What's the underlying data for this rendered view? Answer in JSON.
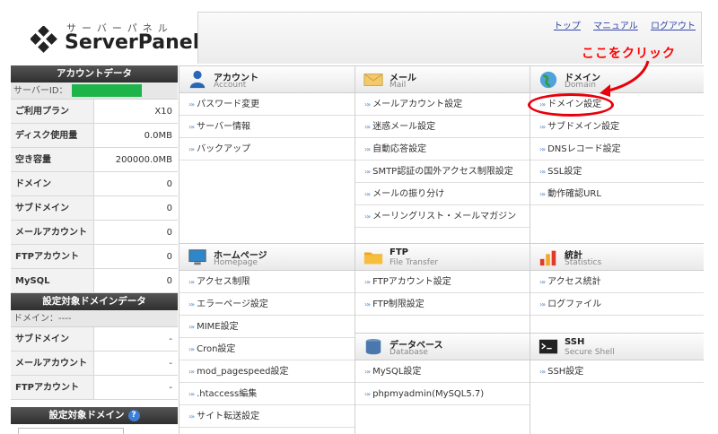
{
  "header": {
    "logo_kana": "サーバーパネル",
    "logo_text": "ServerPanel",
    "links": [
      "トップ",
      "マニュアル",
      "ログアウト"
    ]
  },
  "sidebar": {
    "account_title": "アカウントデータ",
    "server_id_label": "サーバーID：",
    "account_rows": [
      {
        "label": "ご利用プラン",
        "value": "X10"
      },
      {
        "label": "ディスク使用量",
        "value": "0.0MB"
      },
      {
        "label": "空き容量",
        "value": "200000.0MB"
      },
      {
        "label": "ドメイン",
        "value": "0"
      },
      {
        "label": "サブドメイン",
        "value": "0"
      },
      {
        "label": "メールアカウント",
        "value": "0"
      },
      {
        "label": "FTPアカウント",
        "value": "0"
      },
      {
        "label": "MySQL",
        "value": "0"
      }
    ],
    "domain_data_title": "設定対象ドメインデータ",
    "domain_label": "ドメイン：----",
    "domain_rows": [
      {
        "label": "サブドメイン",
        "value": "-"
      },
      {
        "label": "メールアカウント",
        "value": "-"
      },
      {
        "label": "FTPアカウント",
        "value": "-"
      }
    ],
    "target_domain_title": "設定対象ドメイン",
    "help_glyph": "?"
  },
  "panels": {
    "account": {
      "title": "アカウント",
      "sub": "Account",
      "icon": "person-icon",
      "items": [
        "パスワード変更",
        "サーバー情報",
        "バックアップ"
      ]
    },
    "homepage": {
      "title": "ホームページ",
      "sub": "Homepage",
      "icon": "monitor-icon",
      "items": [
        "アクセス制限",
        "エラーページ設定",
        "MIME設定",
        "Cron設定",
        "mod_pagespeed設定",
        ".htaccess編集",
        "サイト転送設定"
      ]
    },
    "mail": {
      "title": "メール",
      "sub": "Mail",
      "icon": "envelope-icon",
      "items": [
        "メールアカウント設定",
        "迷惑メール設定",
        "自動応答設定",
        "SMTP認証の国外アクセス制限設定",
        "メールの振り分け",
        "メーリングリスト・メールマガジン"
      ]
    },
    "ftp": {
      "title": "FTP",
      "sub": "File Transfer",
      "icon": "folder-icon",
      "items": [
        "FTPアカウント設定",
        "FTP制限設定"
      ]
    },
    "database": {
      "title": "データベース",
      "sub": "Database",
      "icon": "database-icon",
      "items": [
        "MySQL設定",
        "phpmyadmin(MySQL5.7)"
      ]
    },
    "domain": {
      "title": "ドメイン",
      "sub": "Domain",
      "icon": "globe-icon",
      "items": [
        "ドメイン設定",
        "サブドメイン設定",
        "DNSレコード設定",
        "SSL設定",
        "動作確認URL"
      ]
    },
    "stats": {
      "title": "統計",
      "sub": "Statistics",
      "icon": "chart-icon",
      "items": [
        "アクセス統計",
        "ログファイル"
      ]
    },
    "ssh": {
      "title": "SSH",
      "sub": "Secure Shell",
      "icon": "terminal-icon",
      "items": [
        "SSH設定"
      ]
    }
  },
  "annotation": {
    "text": "ここをクリック",
    "color": "#ff0000"
  },
  "colors": {
    "server_id_mask": "#1db44a",
    "link": "#3344aa",
    "sidebar_head": "#3a3a3a"
  }
}
